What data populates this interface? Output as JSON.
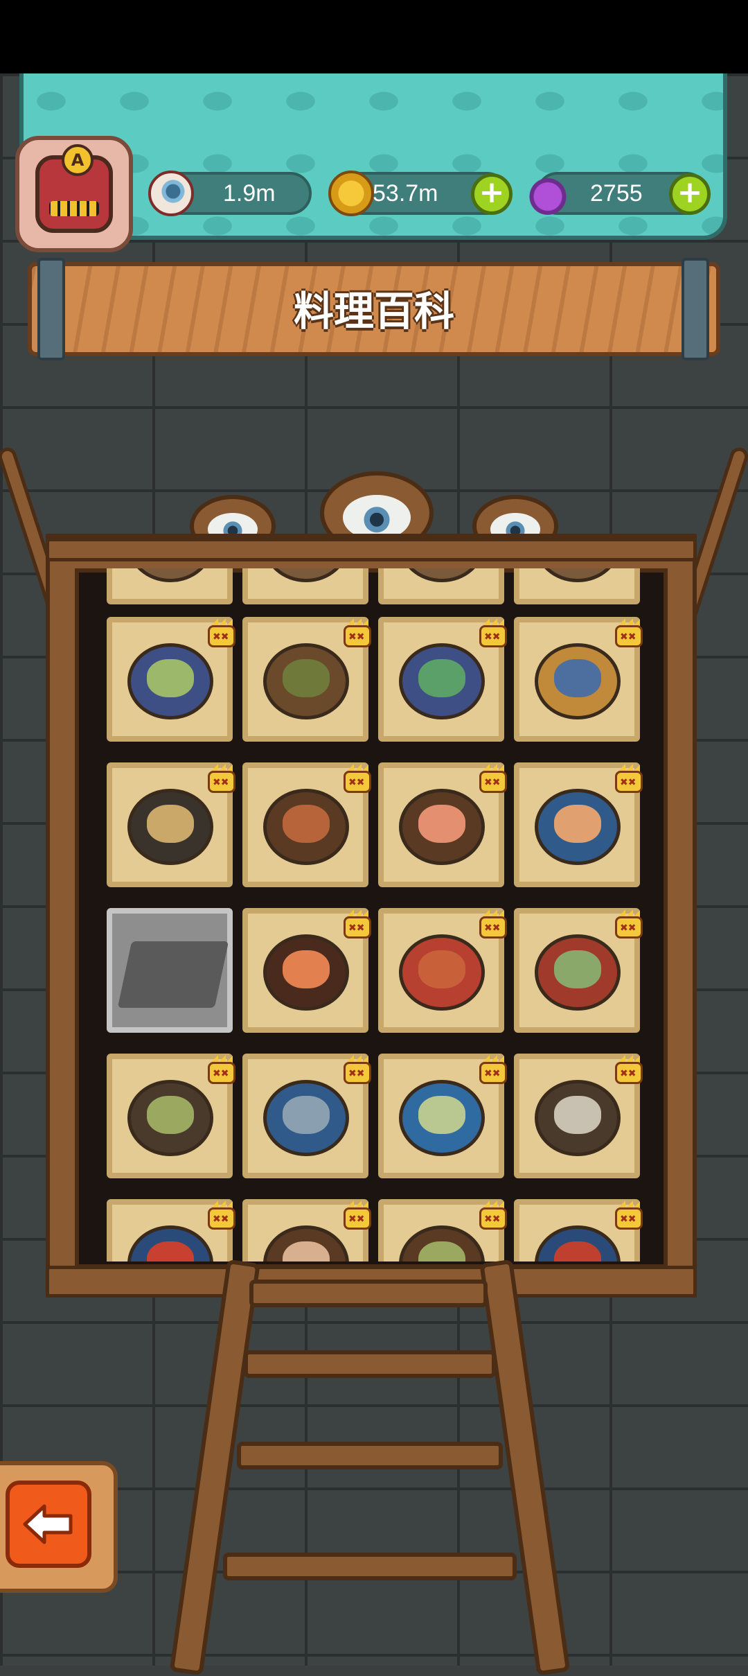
{
  "title": "料理百科",
  "resources": {
    "eyes": {
      "value": "1.9m",
      "icon": "eyeball-icon"
    },
    "coins": {
      "value": "53.7m",
      "icon": "coin-icon"
    },
    "potions": {
      "value": "2755",
      "icon": "potion-icon"
    }
  },
  "player": {
    "rank_letter": "A"
  },
  "dishes": [
    {
      "state": "partial",
      "colors": [
        "#c8b070",
        "#7a5a3a"
      ]
    },
    {
      "state": "partial",
      "colors": [
        "#c8b070",
        "#7a5a3a"
      ]
    },
    {
      "state": "partial",
      "colors": [
        "#c8b070",
        "#7a5a3a"
      ]
    },
    {
      "state": "partial",
      "colors": [
        "#c8b070",
        "#7a5a3a"
      ]
    },
    {
      "state": "unlocked",
      "colors": [
        "#9cb86a",
        "#3e4f86"
      ]
    },
    {
      "state": "unlocked",
      "colors": [
        "#6f7a3a",
        "#6a4a2a"
      ]
    },
    {
      "state": "unlocked",
      "colors": [
        "#5aa068",
        "#3e4f86"
      ]
    },
    {
      "state": "unlocked",
      "colors": [
        "#4d6fa0",
        "#c08a3a"
      ]
    },
    {
      "state": "unlocked",
      "colors": [
        "#c9a86a",
        "#3a332c"
      ]
    },
    {
      "state": "unlocked",
      "colors": [
        "#b8643a",
        "#5a3a22"
      ]
    },
    {
      "state": "unlocked",
      "colors": [
        "#e49070",
        "#5a3a22"
      ]
    },
    {
      "state": "unlocked",
      "colors": [
        "#e0a070",
        "#2f5a8a"
      ]
    },
    {
      "state": "locked",
      "colors": [
        "#5a5a5a",
        "#8e8e8e"
      ]
    },
    {
      "state": "unlocked",
      "colors": [
        "#e28050",
        "#4a2a1c"
      ]
    },
    {
      "state": "unlocked",
      "colors": [
        "#c8603a",
        "#b84030"
      ]
    },
    {
      "state": "unlocked",
      "colors": [
        "#8aa86a",
        "#a03a2a"
      ]
    },
    {
      "state": "unlocked",
      "colors": [
        "#9aa860",
        "#4a3a2c"
      ]
    },
    {
      "state": "unlocked",
      "colors": [
        "#8aa0b0",
        "#2f5a8a"
      ]
    },
    {
      "state": "unlocked",
      "colors": [
        "#b8c890",
        "#2f6aa0"
      ]
    },
    {
      "state": "unlocked",
      "colors": [
        "#c8c0b0",
        "#4a3a2c"
      ]
    },
    {
      "state": "unlocked",
      "colors": [
        "#c84030",
        "#2a4a7a"
      ]
    },
    {
      "state": "unlocked",
      "colors": [
        "#d8b090",
        "#5a3a22"
      ]
    },
    {
      "state": "unlocked",
      "colors": [
        "#9aa860",
        "#5a3a22"
      ]
    },
    {
      "state": "unlocked",
      "colors": [
        "#c04030",
        "#2a4a7a"
      ]
    }
  ],
  "colors": {
    "accent_green": "#9fd321",
    "back_orange": "#f05a1a",
    "panel_teal": "#5ccbc2"
  }
}
